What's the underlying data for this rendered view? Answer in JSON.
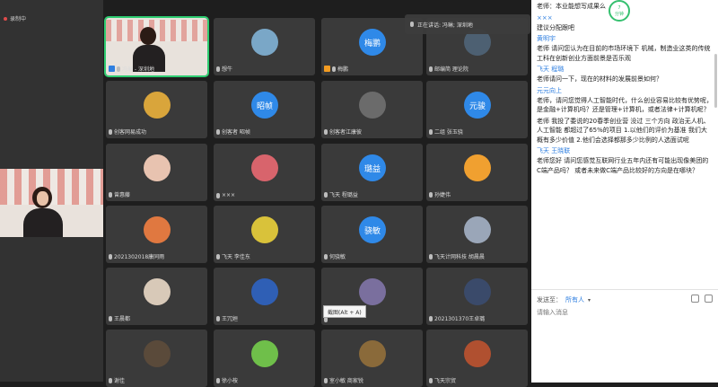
{
  "left_panel": {
    "recording_label": "录制中"
  },
  "speaking": {
    "text": "正在讲话: 冯琳; 深圳地"
  },
  "tooltip": {
    "text": "截图(Alt + A)"
  },
  "participants": [
    {
      "name": "冯琳 - 深圳地",
      "type": "video",
      "badge": "host",
      "active": true
    },
    {
      "name": "想牛",
      "type": "photo",
      "color": "#7aa7c7"
    },
    {
      "name": "梅鹏",
      "type": "blue",
      "initials": "梅鹏",
      "badge": "cohost"
    },
    {
      "name": "邮编简 理论院",
      "type": "photo",
      "color": "#4d6072"
    },
    {
      "name": "创客网易成功",
      "type": "photo",
      "color": "#d9a53b"
    },
    {
      "name": "创客者 昭帧",
      "type": "blue",
      "initials": "昭帧"
    },
    {
      "name": "创客者江康彼",
      "type": "photo",
      "color": "#6b6b6b"
    },
    {
      "name": "二组 张玉骁",
      "type": "blue",
      "initials": "元骏"
    },
    {
      "name": "曾惠藤",
      "type": "photo",
      "color": "#e8c3b0"
    },
    {
      "name": "×××",
      "type": "photo",
      "color": "#d8646c"
    },
    {
      "name": "飞天 程璐益",
      "type": "blue",
      "initials": "璐益"
    },
    {
      "name": "孙婕伟",
      "type": "photo",
      "color": "#f0a030"
    },
    {
      "name": "2021302018康同雨",
      "type": "photo",
      "color": "#e07840"
    },
    {
      "name": "飞天 李佳东",
      "type": "photo",
      "color": "#d9c23a"
    },
    {
      "name": "何骁敏",
      "type": "blue",
      "initials": "骁敏"
    },
    {
      "name": "飞天计网科技 胡晨晨",
      "type": "photo",
      "color": "#9aa6b8"
    },
    {
      "name": "王晨都",
      "type": "photo",
      "color": "#d8c9b8"
    },
    {
      "name": "王冗姮",
      "type": "photo",
      "color": "#2f5fb5"
    },
    {
      "name": "",
      "type": "photo",
      "color": "#7a6f9e"
    },
    {
      "name": "2021301370王卓璐",
      "type": "photo",
      "color": "#3a4a6a"
    },
    {
      "name": "谢佳",
      "type": "photo",
      "color": "#5a4a3a"
    },
    {
      "name": "徐小桉",
      "type": "photo",
      "color": "#6fbf4a"
    },
    {
      "name": "室小敏 商家锐",
      "type": "photo",
      "color": "#8a6a3a"
    },
    {
      "name": "飞天宗贸",
      "type": "photo",
      "color": "#b05030"
    }
  ],
  "chat": {
    "timer": {
      "value": "7",
      "unit": "分钟"
    },
    "messages": [
      {
        "sender": "",
        "text": "老师：本业能想写成果么"
      },
      {
        "sender": "×××",
        "text": "建议分配跟吧"
      },
      {
        "sender": "黄明宇",
        "text": "老师 请问您认为在目前的市场环境下 机械，制造业这类的传统工科在创新创业方面前景是否乐观"
      },
      {
        "sender": "飞天 程璐",
        "text": "老师请问一下，现在的材料的发展前景如何？"
      },
      {
        "sender": "元元向上",
        "text": "老师，请问您觉得人工智能时代，什么创业容易比较有优势呢，是金融+计算机吗？还是管理+计算机，或者法律+计算机呢？"
      },
      {
        "sender": "",
        "text": "老师 我投了委说的20春季创业营 没过 三个方向 政治无人机、人工智能 都超过了65%的项目 1.以他们的评价为基准 我们大概有多少价值 2.他们会选择都那多少比例的人选面试呢"
      },
      {
        "sender": "飞天 王晓联",
        "text": "老师您好 请问您感觉互联网行业五年内还有可能出现像美团的C端产品吗？ 或者未来做C端产品比较好的方向是在哪块？"
      }
    ]
  },
  "compose": {
    "to_label": "发送至：",
    "to_target": "所有人",
    "placeholder": "请输入消息"
  }
}
